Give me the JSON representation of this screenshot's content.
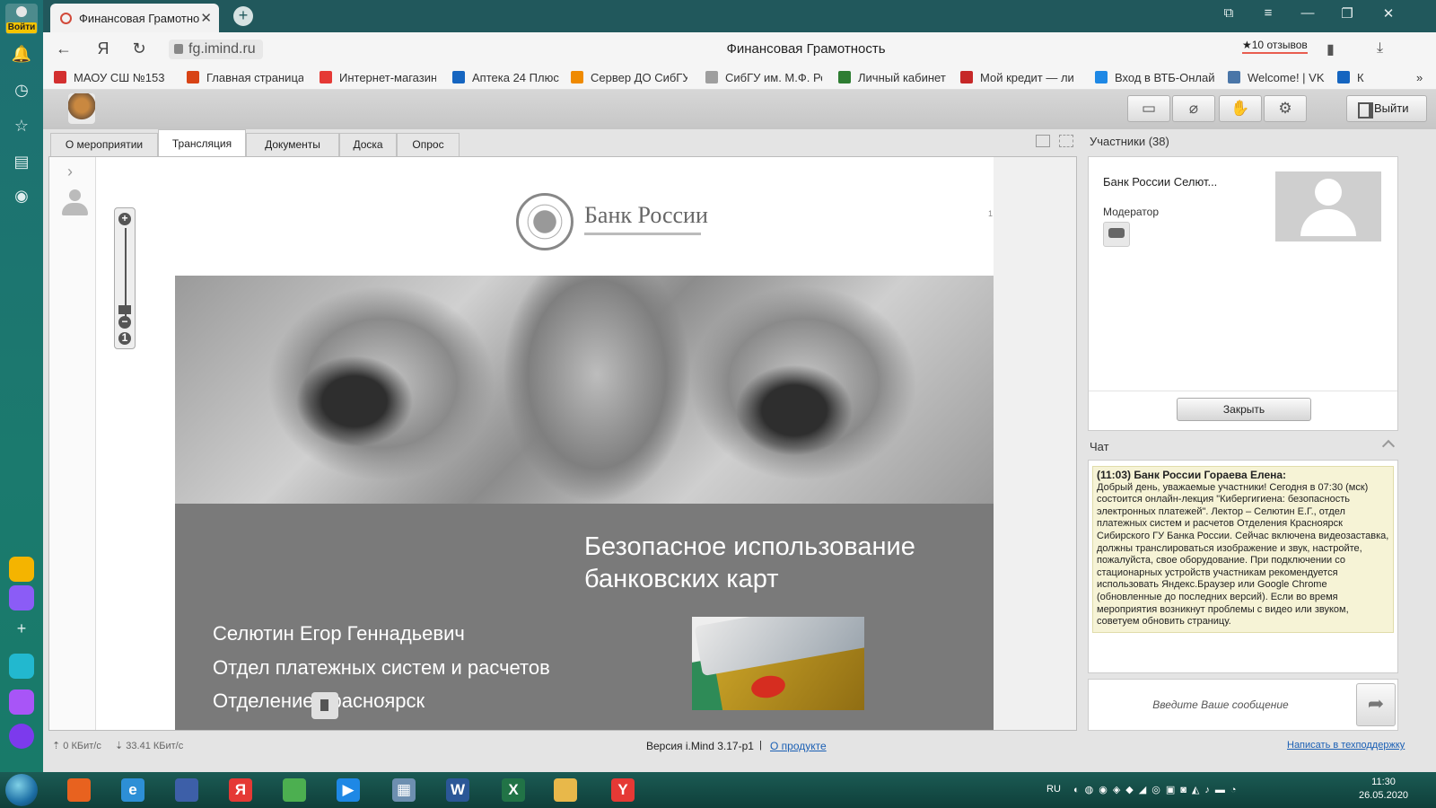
{
  "yandex_sidebar": {
    "login_label": "Войти"
  },
  "tab": {
    "title": "Финансовая Грамотность",
    "close": "✕",
    "new_tab": "+"
  },
  "window_controls": [
    "⧉",
    "≡",
    "—",
    "❐",
    "✕"
  ],
  "address": {
    "back": "←",
    "yandex": "Я",
    "reload": "↻",
    "url": "fg.imind.ru",
    "page_title": "Финансовая Грамотность",
    "reviews": "★10 отзывов"
  },
  "bookmarks": [
    {
      "label": "МАОУ СШ №153",
      "color": "#d32f2f"
    },
    {
      "label": "Главная страница",
      "color": "#d84315"
    },
    {
      "label": "Интернет-магазин",
      "color": "#e53935"
    },
    {
      "label": "Аптека 24 Плюс",
      "color": "#1565c0"
    },
    {
      "label": "Сервер ДО СибГУ",
      "color": "#ef8a00"
    },
    {
      "label": "СибГУ им. М.Ф. Ре",
      "color": "#9e9e9e"
    },
    {
      "label": "Личный кабинет",
      "color": "#2e7d32"
    },
    {
      "label": "Мой кредит — ли",
      "color": "#c62828"
    },
    {
      "label": "Вход в ВТБ-Онлай",
      "color": "#1e88e5"
    },
    {
      "label": "Welcome! | VK",
      "color": "#4a76a8"
    },
    {
      "label": "Кс",
      "color": "#1565c0"
    }
  ],
  "bookmarks_more": "»",
  "app": {
    "exit_label": "Выйти",
    "toolbar_icons": [
      "camera-off-icon",
      "mic-off-icon",
      "raise-hand-icon",
      "gear-icon"
    ],
    "tabs": [
      "О мероприятии",
      "Трансляция",
      "Документы",
      "Доска",
      "Опрос"
    ],
    "active_tab": "Трансляция"
  },
  "slide": {
    "bank_name": "Банк России",
    "page_mark": "1",
    "title": "Безопасное использование банковских карт",
    "lines": [
      "Селютин Егор Геннадьевич",
      "Отдел платежных систем и расчетов",
      "Отделение Красноярск"
    ]
  },
  "participants": {
    "header": "Участники (38)",
    "name": "Банк России Селют...",
    "role": "Модератор",
    "close_button": "Закрыть"
  },
  "chat": {
    "header": "Чат",
    "message_header": "(11:03) Банк России Гораева Елена:",
    "message_body": "Добрый день, уважаемые участники! Сегодня в 07:30 (мск) состоится онлайн-лекция \"Кибергигиена: безопасность электронных платежей\". Лектор – Селютин Е.Г., отдел платежных систем и расчетов Отделения Красноярск Сибирского ГУ Банка России. Сейчас включена видеозаставка, должны транслироваться изображение и звук, настройте, пожалуйста, свое оборудование. При подключении со стационарных устройств участникам рекомендуется использовать Яндекс.Браузер или Google Chrome (обновленные до последних версий). Если во время мероприятия возникнут проблемы с видео или звуком, советуем обновить страницу.",
    "input_placeholder": "Введите Ваше сообщение",
    "send_icon": "➦"
  },
  "status_bar": {
    "up_speed": "0 КБит/с",
    "down_speed": "33.41 КБит/с",
    "version": "Версия i.Mind 3.17-p1",
    "separator": "|",
    "about": "О продукте",
    "support": "Написать в техподдержку"
  },
  "taskbar": {
    "lang": "RU",
    "time": "11:30",
    "date": "26.05.2020",
    "apps": [
      {
        "name": "firefox",
        "glyph": "",
        "color": "#e8621f"
      },
      {
        "name": "internet-explorer",
        "glyph": "e",
        "color": "#2d8fd6"
      },
      {
        "name": "floppy",
        "glyph": "",
        "color": "#3d5fa8"
      },
      {
        "name": "yandex",
        "glyph": "Я",
        "color": "#e53935"
      },
      {
        "name": "chrome",
        "glyph": "",
        "color": "#4caf50"
      },
      {
        "name": "media-player",
        "glyph": "▶",
        "color": "#1e88e5"
      },
      {
        "name": "calculator",
        "glyph": "▦",
        "color": "#6d8fb0"
      },
      {
        "name": "word",
        "glyph": "W",
        "color": "#2b5797"
      },
      {
        "name": "excel",
        "glyph": "X",
        "color": "#217346"
      },
      {
        "name": "explorer",
        "glyph": "",
        "color": "#e8b84a"
      },
      {
        "name": "yandex-browser",
        "glyph": "Y",
        "color": "#e53935"
      }
    ]
  }
}
